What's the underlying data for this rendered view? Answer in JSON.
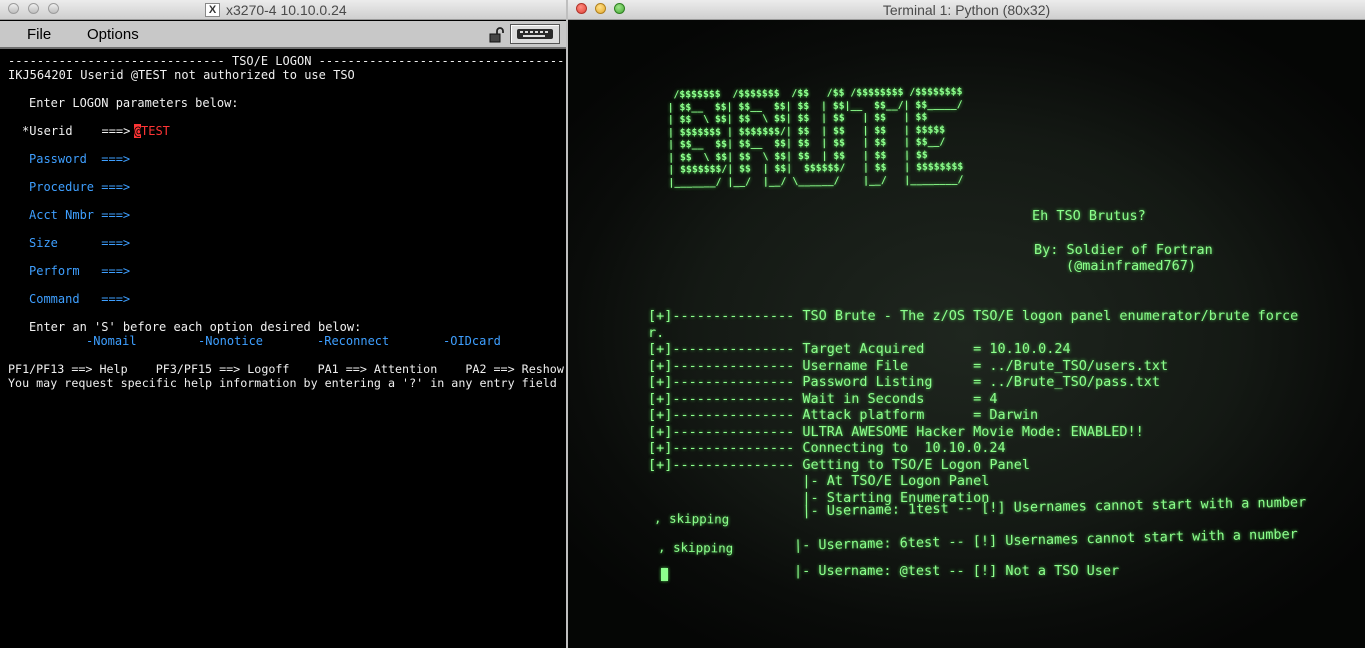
{
  "x3270": {
    "window_title": "x3270-4 10.10.0.24",
    "menu": {
      "file": "File",
      "options": "Options"
    },
    "lines": {
      "header": "------------------------------ TSO/E LOGON -----------------------------------",
      "message": "IKJ56420I Userid @TEST not authorized to use TSO",
      "enter_params": "Enter LOGON parameters below:",
      "userid_label": "*Userid    ===>",
      "userid_cursor_char": "@",
      "userid_value": "TEST",
      "password_label": "Password  ===>",
      "procedure_label": "Procedure ===>",
      "acct_label": "Acct Nmbr ===>",
      "size_label": "Size      ===>",
      "perform_label": "Perform   ===>",
      "command_label": "Command   ===>",
      "options_prompt": "Enter an 'S' before each option desired below:",
      "opt_nomail": "-Nomail",
      "opt_nonotice": "-Nonotice",
      "opt_reconnect": "-Reconnect",
      "opt_oidcard": "-OIDcard",
      "pf_keys": "PF1/PF13 ==> Help    PF3/PF15 ==> Logoff    PA1 ==> Attention    PA2 ==> Reshow",
      "help_hint": "You may request specific help information by entering a '?' in any entry field"
    },
    "colors": {
      "background": "#000000",
      "text": "#f0f0f0",
      "field": "#3e9fff",
      "input": "#ff3535"
    }
  },
  "terminal": {
    "window_title": "Terminal 1: Python (80x32)",
    "banner_art": [
      " /$$$$$$$  /$$$$$$$  /$$   /$$ /$$$$$$$$ /$$$$$$$$",
      "| $$__  $$| $$__  $$| $$  | $$|__  $$__/| $$_____/",
      "| $$  \\ $$| $$  \\ $$| $$  | $$   | $$   | $$",
      "| $$$$$$$ | $$$$$$$/| $$  | $$   | $$   | $$$$$",
      "| $$__  $$| $$__  $$| $$  | $$   | $$   | $$__/",
      "| $$  \\ $$| $$  \\ $$| $$  | $$   | $$   | $$",
      "| $$$$$$$/| $$  | $$|  $$$$$$/   | $$   | $$$$$$$$",
      "|_______/ |__/  |__/ \\______/    |__/   |________/"
    ],
    "tagline": "Eh TSO Brutus?",
    "byline": "By: Soldier of Fortran",
    "handle": "(@mainframed767)",
    "log_lines": [
      "[+]--------------- TSO Brute - The z/OS TSO/E logon panel enumerator/brute force",
      "r.",
      "[+]--------------- Target Acquired      = 10.10.0.24",
      "[+]--------------- Username File        = ../Brute_TSO/users.txt",
      "[+]--------------- Password Listing     = ../Brute_TSO/pass.txt",
      "[+]--------------- Wait in Seconds      = 4",
      "[+]--------------- Attack platform      = Darwin",
      "[+]--------------- ULTRA AWESOME Hacker Movie Mode: ENABLED!!",
      "[+]--------------- Connecting to  10.10.0.24",
      "[+]--------------- Getting to TSO/E Logon Panel",
      "                   |- At TSO/E Logon Panel",
      "                   |- Starting Enumeration",
      "                   |- Username: 1test -- [!] Usernames cannot start with a number"
    ],
    "skip_1": ", skipping",
    "line_6test": "|- Username: 6test -- [!] Usernames cannot start with a number",
    "skip_2": ", skipping",
    "line_attest": "|- Username: @test -- [!] Not a TSO User",
    "colors": {
      "phosphor": "#8dff8d",
      "screen": "#141914"
    }
  }
}
